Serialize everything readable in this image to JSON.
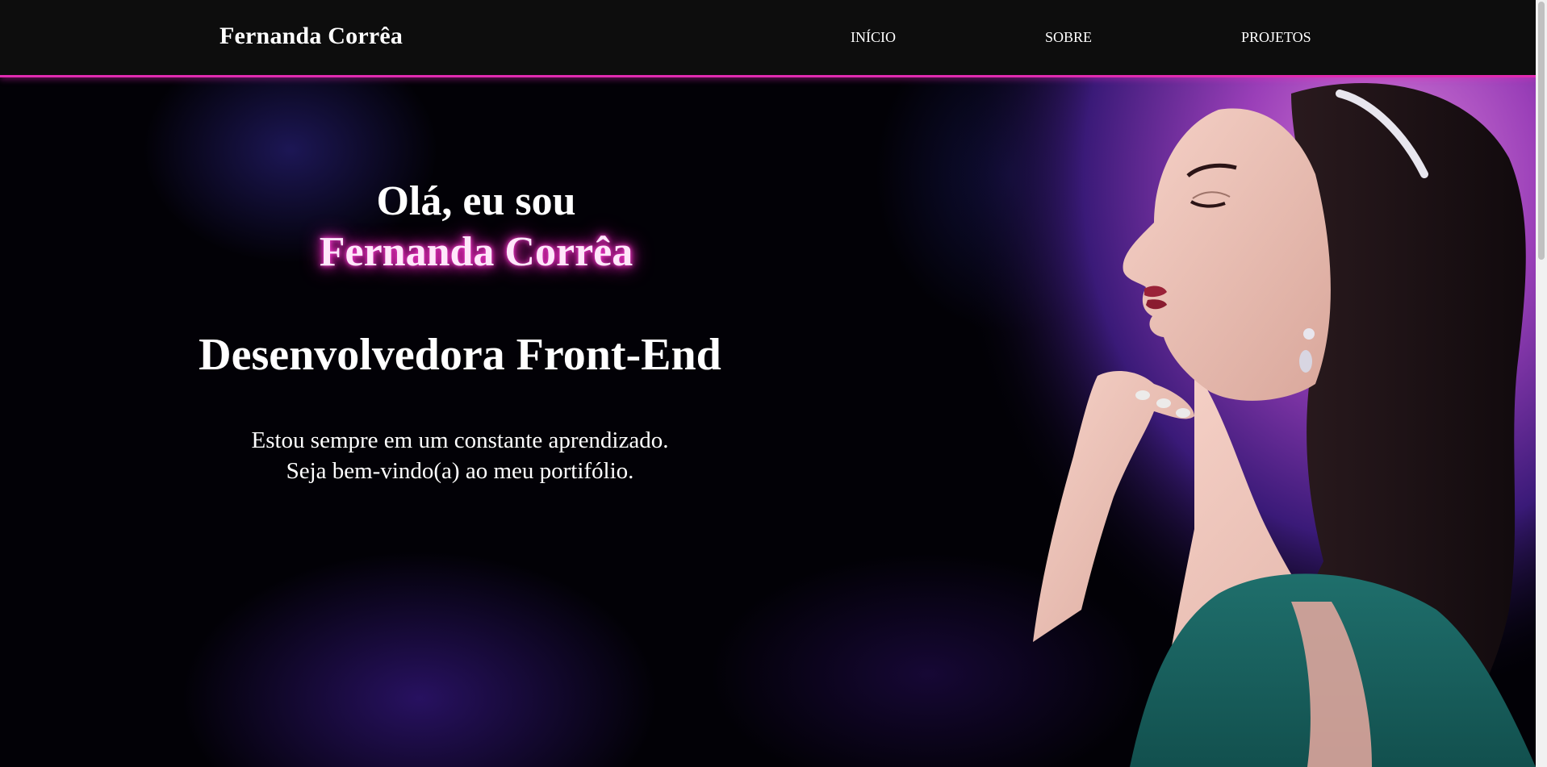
{
  "header": {
    "brand": "Fernanda Corrêa",
    "nav": [
      {
        "label": "INÍCIO"
      },
      {
        "label": "SOBRE"
      },
      {
        "label": "PROJETOS"
      }
    ]
  },
  "hero": {
    "greeting": "Olá, eu sou",
    "name": "Fernanda Corrêa",
    "role": "Desenvolvedora Front-End",
    "tagline_line1": "Estou sempre em um constante aprendizado.",
    "tagline_line2": "Seja bem-vindo(a) ao meu portifólio."
  },
  "colors": {
    "accent": "#e02bb0",
    "header_bg": "#0d0d0d",
    "hero_bg": "#020106",
    "glow": "#ff2bc8"
  },
  "icons": [
    "profile-photo"
  ]
}
